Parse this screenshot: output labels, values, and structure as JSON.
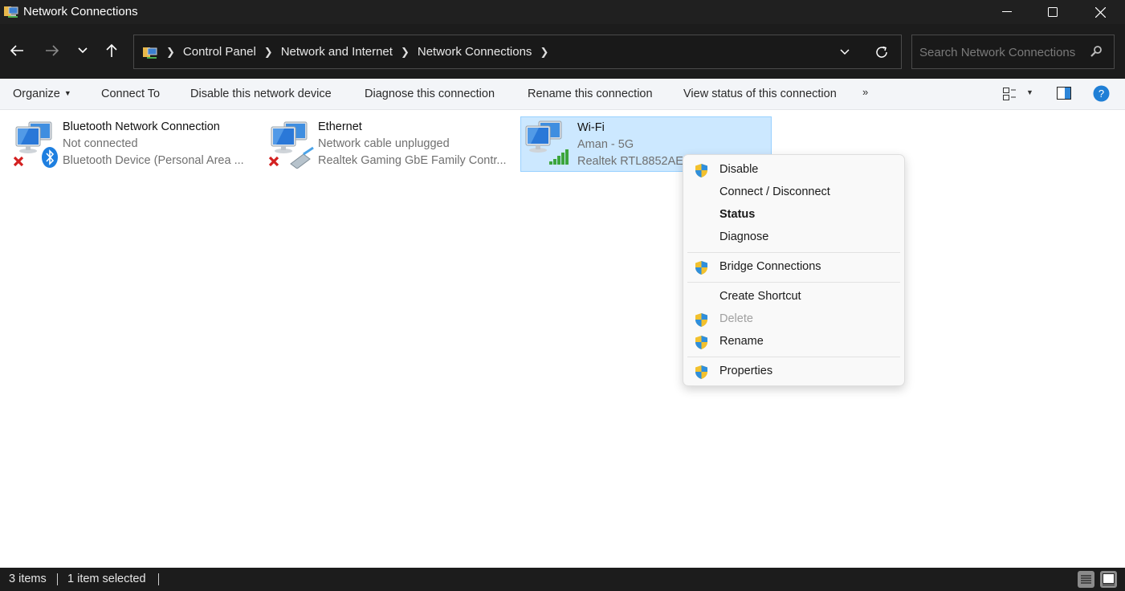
{
  "window": {
    "title": "Network Connections",
    "icon": "network-folder-icon",
    "controls": {
      "minimize": "minimize-icon",
      "maximize": "maximize-icon",
      "close": "close-icon"
    }
  },
  "nav": {
    "back": "arrow-left-icon",
    "forward": "arrow-right-icon",
    "recent": "chevron-down-icon",
    "up": "arrow-up-icon",
    "breadcrumbs": [
      "Control Panel",
      "Network and Internet",
      "Network Connections"
    ],
    "refresh": "refresh-icon",
    "search_placeholder": "Search Network Connections"
  },
  "commandbar": {
    "items": [
      {
        "label": "Organize",
        "has_dropdown": true
      },
      {
        "label": "Connect To"
      },
      {
        "label": "Disable this network device"
      },
      {
        "label": "Diagnose this connection"
      },
      {
        "label": "Rename this connection"
      },
      {
        "label": "View status of this connection"
      }
    ],
    "more": "»",
    "right_icons": [
      "change-view-icon",
      "view-dropdown-icon",
      "preview-pane-icon",
      "help-icon"
    ]
  },
  "connections": [
    {
      "name": "Bluetooth Network Connection",
      "status": "Not connected",
      "device": "Bluetooth Device (Personal Area ...",
      "selected": false,
      "badge": "disconnected-x-icon",
      "overlay": "bluetooth-icon"
    },
    {
      "name": "Ethernet",
      "status": "Network cable unplugged",
      "device": "Realtek Gaming GbE Family Contr...",
      "selected": false,
      "badge": "disconnected-x-icon",
      "overlay": "ethernet-cable-icon"
    },
    {
      "name": "Wi-Fi",
      "status": "Aman - 5G",
      "device": "Realtek RTL8852AE",
      "selected": true,
      "overlay": "wifi-signal-bars-icon"
    }
  ],
  "context_menu": {
    "items": [
      {
        "label": "Disable",
        "shield": true
      },
      {
        "label": "Connect / Disconnect",
        "shield": false
      },
      {
        "label": "Status",
        "shield": false,
        "bold": true
      },
      {
        "label": "Diagnose",
        "shield": false
      },
      {
        "label": "Bridge Connections",
        "shield": true
      },
      {
        "label": "Create Shortcut",
        "shield": false
      },
      {
        "label": "Delete",
        "shield": true,
        "disabled": true
      },
      {
        "label": "Rename",
        "shield": true
      },
      {
        "label": "Properties",
        "shield": true
      }
    ]
  },
  "statusbar": {
    "item_count": "3 items",
    "selection": "1 item selected",
    "view_buttons": [
      "details-view-icon",
      "large-icons-view-icon"
    ]
  },
  "colors": {
    "titlebar_bg": "#202020",
    "selection_bg": "#cce8ff",
    "selection_border": "#99d1ff",
    "help_blue": "#1f7fd6",
    "shield_yellow": "#f2c12e",
    "shield_blue": "#2f8fdc"
  }
}
